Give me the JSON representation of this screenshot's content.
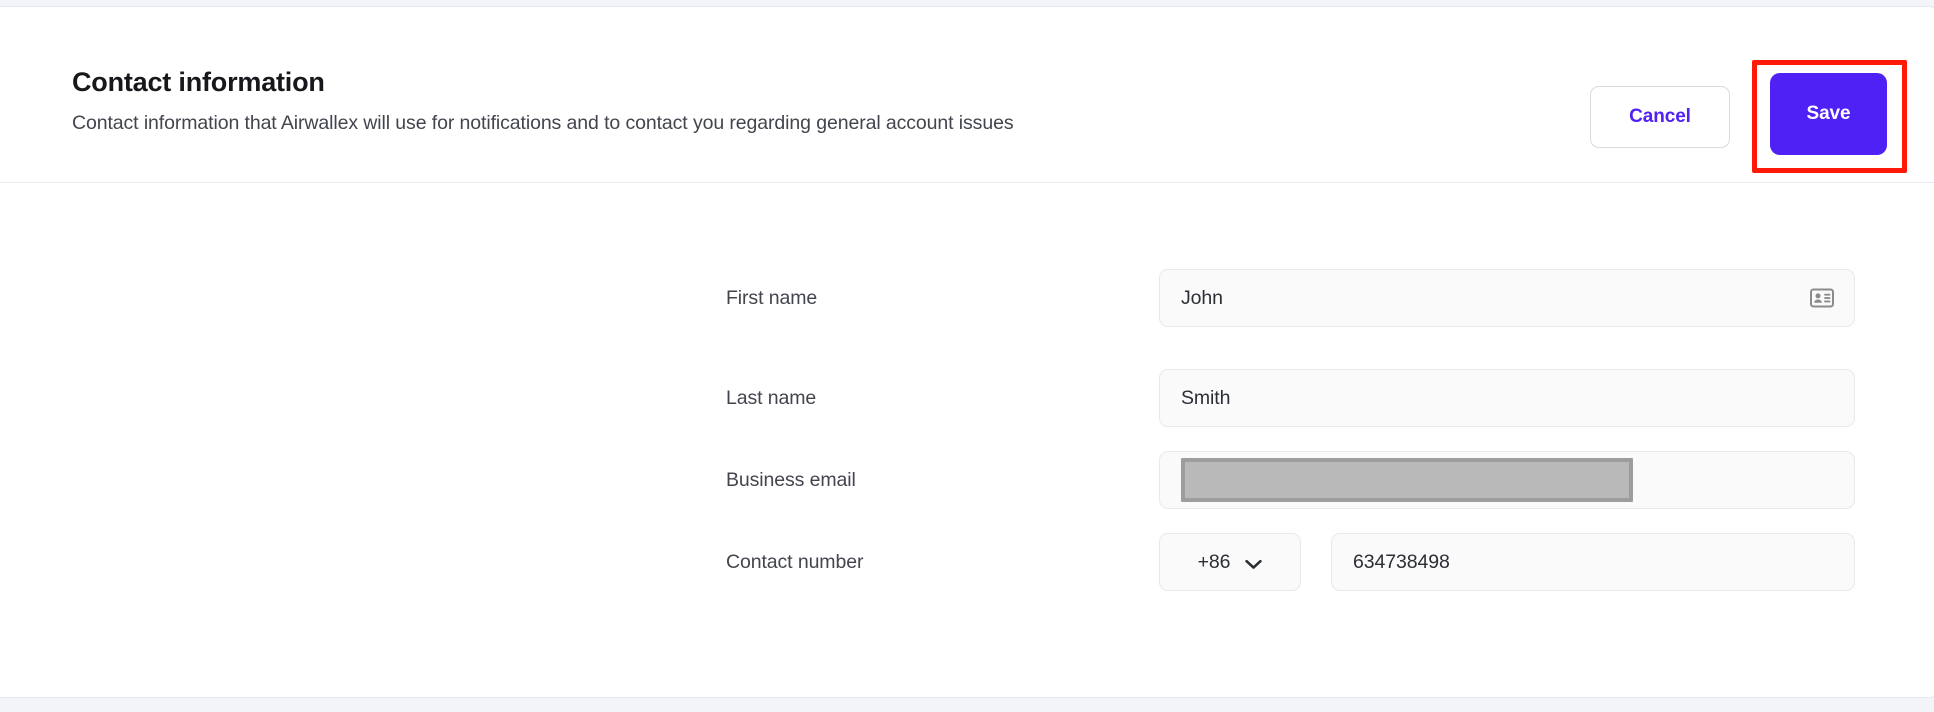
{
  "card": {
    "header": {
      "title": "Contact information",
      "subtitle": "Contact information that Airwallex will use for notifications and to contact you regarding general account issues",
      "actions": {
        "cancel_label": "Cancel",
        "save_label": "Save",
        "highlight_color": "#fe1a09",
        "accent_color": "#4f21f5"
      }
    },
    "form": {
      "fields": [
        {
          "label": "First name",
          "value": "John",
          "placeholder": "First name",
          "icon": "contact-card-icon"
        },
        {
          "label": "Last name",
          "value": "Smith",
          "placeholder": "Last name"
        },
        {
          "label": "Business email",
          "value": "",
          "placeholder": "Business email",
          "redacted": true
        },
        {
          "label": "Contact number",
          "country_code": "+86",
          "value": "634738498",
          "placeholder": "Contact number",
          "icon": "chevron-down-icon"
        }
      ]
    }
  }
}
